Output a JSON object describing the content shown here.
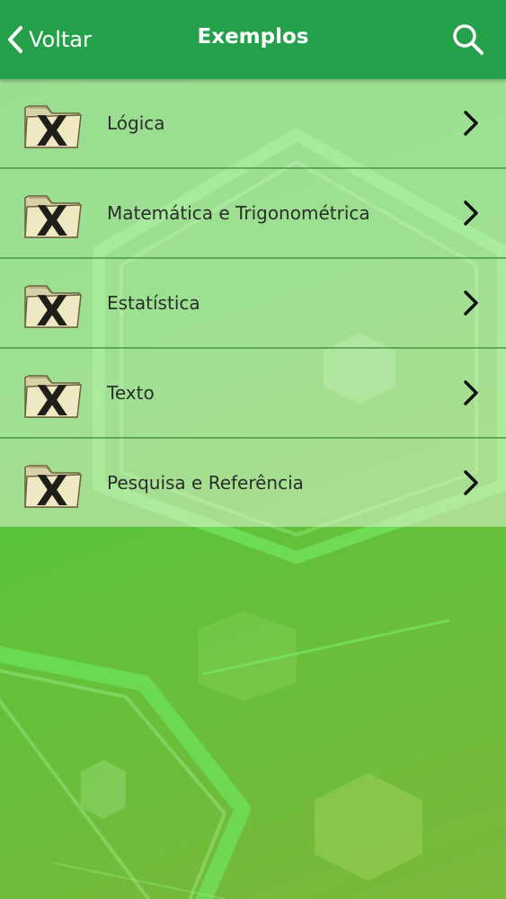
{
  "appbar": {
    "back_label": "Voltar",
    "title": "Exemplos",
    "color": "#25a04b"
  },
  "list": {
    "items": [
      {
        "label": "Lógica",
        "icon": "excel-folder-icon"
      },
      {
        "label": "Matemática e Trigonométrica",
        "icon": "excel-folder-icon"
      },
      {
        "label": "Estatística",
        "icon": "excel-folder-icon"
      },
      {
        "label": "Texto",
        "icon": "excel-folder-icon"
      },
      {
        "label": "Pesquisa e Referência",
        "icon": "excel-folder-icon"
      }
    ]
  },
  "colors": {
    "background": "#4cc640",
    "item_text": "#2a2f2a"
  }
}
